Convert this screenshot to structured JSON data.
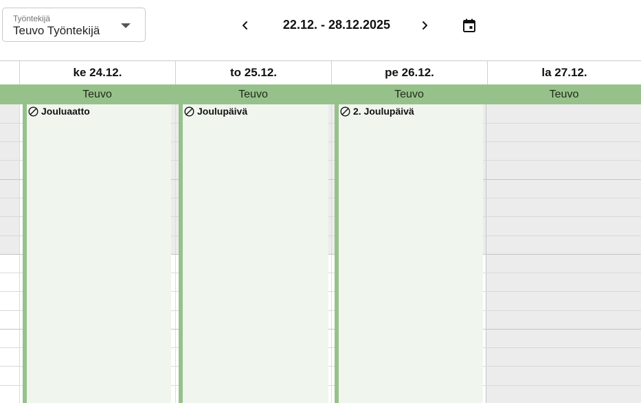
{
  "employee_select": {
    "label": "Työntekijä",
    "value": "Teuvo Työntekijä"
  },
  "nav": {
    "date_range": "22.12. - 28.12.2025"
  },
  "days": [
    {
      "header": "ke 24.12.",
      "employee": "Teuvo",
      "event": "Jouluaatto"
    },
    {
      "header": "to 25.12.",
      "employee": "Teuvo",
      "event": "Joulupäivä"
    },
    {
      "header": "pe 26.12.",
      "employee": "Teuvo",
      "event": "2. Joulupäivä"
    },
    {
      "header": "la 27.12.",
      "employee": "Teuvo",
      "event": ""
    }
  ],
  "colors": {
    "employee_row": "#97c18a",
    "event_background": "#f0f5ee",
    "event_border": "#97c18a",
    "weekend_background": "#ececec"
  },
  "icons": {
    "prev": "chevron-left-icon",
    "next": "chevron-right-icon",
    "calendar": "calendar-icon",
    "dropdown": "caret-down-icon",
    "event": "ban-icon"
  }
}
